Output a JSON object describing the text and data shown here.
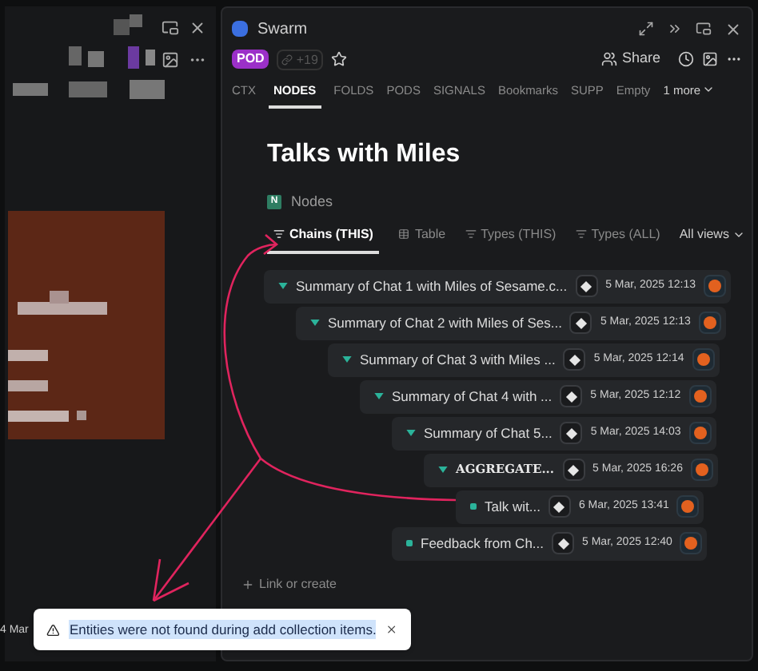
{
  "left_panel": {
    "date_fragment": "4 Mar"
  },
  "window": {
    "title": "Swarm",
    "badge": "POD",
    "link_count": "+19",
    "share": "Share"
  },
  "tabs": [
    {
      "label": "CTX",
      "selected": false
    },
    {
      "label": "NODES",
      "selected": true
    },
    {
      "label": "FOLDS",
      "selected": false
    },
    {
      "label": "PODS",
      "selected": false
    },
    {
      "label": "SIGNALS",
      "selected": false
    },
    {
      "label": "Bookmarks",
      "selected": false
    },
    {
      "label": "SUPP",
      "selected": false
    },
    {
      "label": "Empty",
      "selected": false
    }
  ],
  "more_tabs": "1 more",
  "page": {
    "title": "Talks with Miles",
    "section_letter": "N",
    "section": "Nodes"
  },
  "views": [
    {
      "label": "Chains (THIS)",
      "kind": "chain",
      "selected": true
    },
    {
      "label": "Table",
      "kind": "table",
      "selected": false
    },
    {
      "label": "Types (THIS)",
      "kind": "chain",
      "selected": false
    },
    {
      "label": "Types (ALL)",
      "kind": "chain",
      "selected": false
    }
  ],
  "all_views": "All views",
  "nodes": [
    {
      "title": "Summary of Chat 1 with Miles of Sesame.c...",
      "date": "5 Mar, 2025 12:13",
      "kind": "branch",
      "children": [
        {
          "title": "Summary of Chat 2 with Miles of Ses...",
          "date": "5 Mar, 2025 12:13",
          "kind": "branch",
          "children": [
            {
              "title": "Summary of Chat 3 with Miles ...",
              "date": "5 Mar, 2025 12:14",
              "kind": "branch",
              "children": [
                {
                  "title": "Summary of Chat 4 with ...",
                  "date": "5 Mar, 2025 12:12",
                  "kind": "branch",
                  "children": [
                    {
                      "title": "Summary of Chat 5...",
                      "date": "5 Mar, 2025 14:03",
                      "kind": "branch",
                      "children": [
                        {
                          "title": "AGGREGATE...",
                          "date": "5 Mar, 2025 16:26",
                          "kind": "aggregate",
                          "children": [
                            {
                              "title": "Talk wit...",
                              "date": "6 Mar, 2025 13:41",
                              "kind": "leaf"
                            }
                          ]
                        }
                      ]
                    },
                    {
                      "title": "Feedback from Ch...",
                      "date": "5 Mar, 2025 12:40",
                      "kind": "leaf"
                    }
                  ]
                }
              ]
            }
          ]
        }
      ]
    }
  ],
  "link_create": "Link or create",
  "toast": {
    "message": "Entities were not found during add collection items.",
    "selected_text": true
  }
}
